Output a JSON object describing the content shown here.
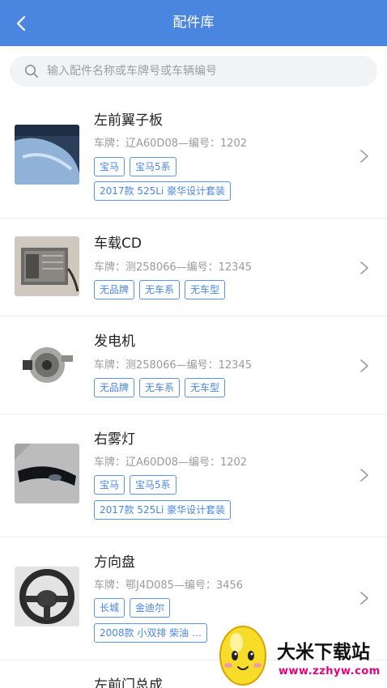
{
  "header": {
    "title": "配件库",
    "back_icon": "chevron-left-icon"
  },
  "search": {
    "placeholder": "输入配件名称或车牌号或车辆编号",
    "value": ""
  },
  "colors": {
    "primary": "#4a86e0",
    "tag_border": "#5b94e6"
  },
  "parts": [
    {
      "name": "左前翼子板",
      "plate_label": "车牌：辽A60D08—编号：1202",
      "tags_row1": [
        "宝马",
        "宝马5系"
      ],
      "tags_row2": [
        "2017款 525Li 豪华设计套装"
      ],
      "thumb": "fender"
    },
    {
      "name": "车载CD",
      "plate_label": "车牌：测258066—编号：12345",
      "tags_row1": [
        "无品牌",
        "无车系",
        "无车型"
      ],
      "tags_row2": [],
      "thumb": "cd-player"
    },
    {
      "name": "发电机",
      "plate_label": "车牌：测258066—编号：12345",
      "tags_row1": [
        "无品牌",
        "无车系",
        "无车型"
      ],
      "tags_row2": [],
      "thumb": "alternator"
    },
    {
      "name": "右雾灯",
      "plate_label": "车牌：辽A60D08—编号：1202",
      "tags_row1": [
        "宝马",
        "宝马5系"
      ],
      "tags_row2": [
        "2017款 525Li 豪华设计套装"
      ],
      "thumb": "fog-lamp"
    },
    {
      "name": "方向盘",
      "plate_label": "车牌：鄂J4D085—编号：3456",
      "tags_row1": [
        "长城",
        "金迪尔"
      ],
      "tags_row2": [
        "2008款 小双排 柴油 …"
      ],
      "thumb": "steering-wheel"
    },
    {
      "name": "左前门总成",
      "plate_label": "",
      "tags_row1": [],
      "tags_row2": [],
      "thumb": ""
    }
  ],
  "watermark": {
    "line1": "大米下载站",
    "line2": "www.zzhyw.com"
  }
}
